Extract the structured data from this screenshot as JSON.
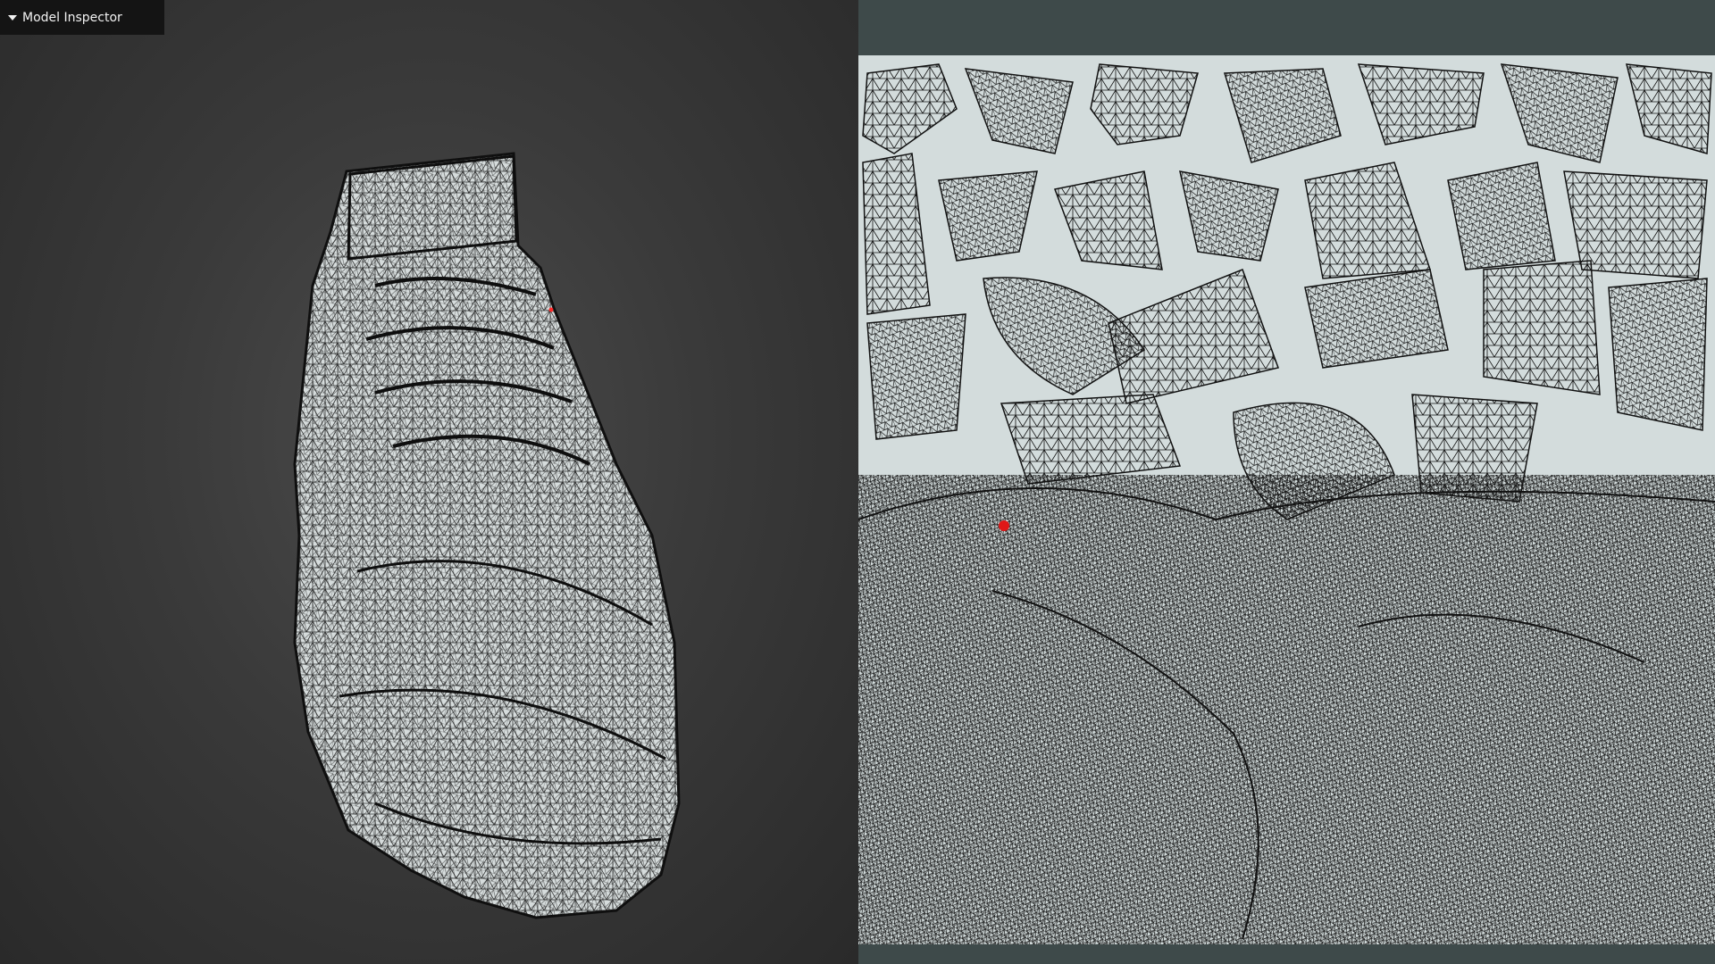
{
  "inspector": {
    "title": "Model Inspector",
    "icon": "triangle-down-icon"
  },
  "viewport": {
    "object": "shoe-wireframe-mesh",
    "background_color": "#3a3a3a",
    "mesh_fill": "#d6dcdc",
    "wire_color": "#111111",
    "marker_color": "#ff2a2a"
  },
  "uv_view": {
    "background_color": "#3e4a4a",
    "canvas_color": "#d3dcdc",
    "marker_color": "#e01818"
  }
}
